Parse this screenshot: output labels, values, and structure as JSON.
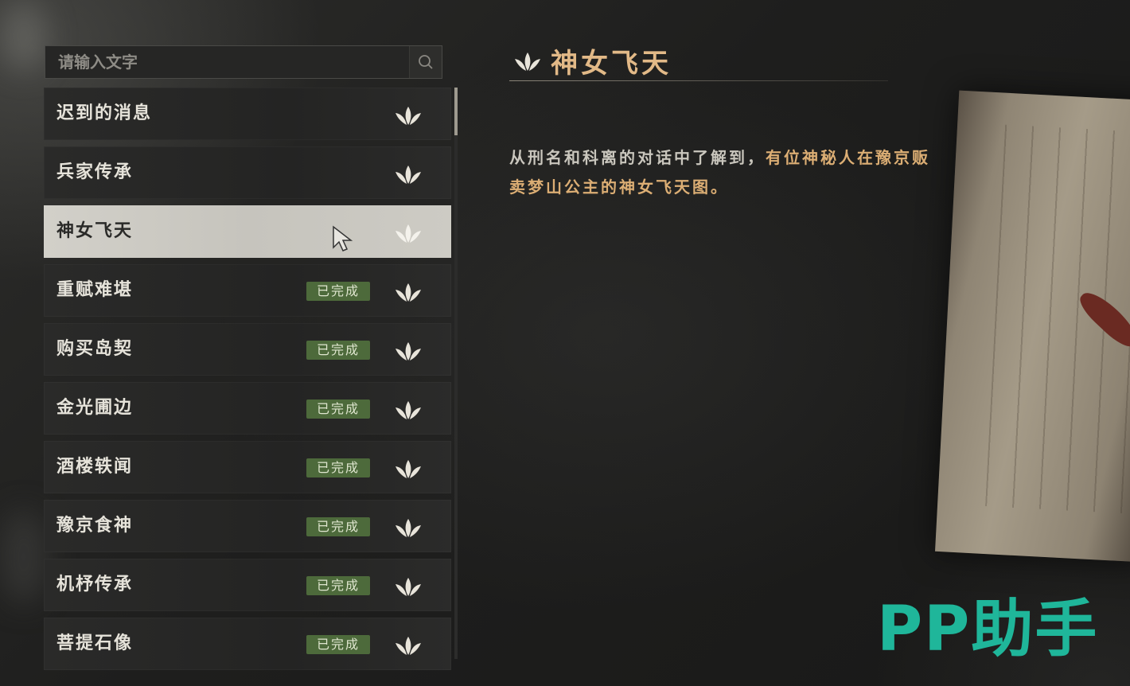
{
  "search": {
    "placeholder": "请输入文字"
  },
  "quests": [
    {
      "name": "迟到的消息",
      "status": ""
    },
    {
      "name": "兵家传承",
      "status": ""
    },
    {
      "name": "神女飞天",
      "status": "",
      "selected": true
    },
    {
      "name": "重赋难堪",
      "status": "已完成"
    },
    {
      "name": "购买岛契",
      "status": "已完成"
    },
    {
      "name": "金光圃边",
      "status": "已完成"
    },
    {
      "name": "酒楼轶闻",
      "status": "已完成"
    },
    {
      "name": "豫京食神",
      "status": "已完成"
    },
    {
      "name": "机杼传承",
      "status": "已完成"
    },
    {
      "name": "菩提石像",
      "status": "已完成"
    }
  ],
  "detail": {
    "title": "神女飞天",
    "desc_plain": "从刑名和科离的对话中了解到，",
    "desc_highlight": "有位神秘人在豫京贩卖梦山公主的神女飞天图。"
  },
  "watermark": "PP助手",
  "colors": {
    "accent": "#e2b987",
    "badge": "#4d6a3b",
    "watermark": "#1fb69a"
  }
}
